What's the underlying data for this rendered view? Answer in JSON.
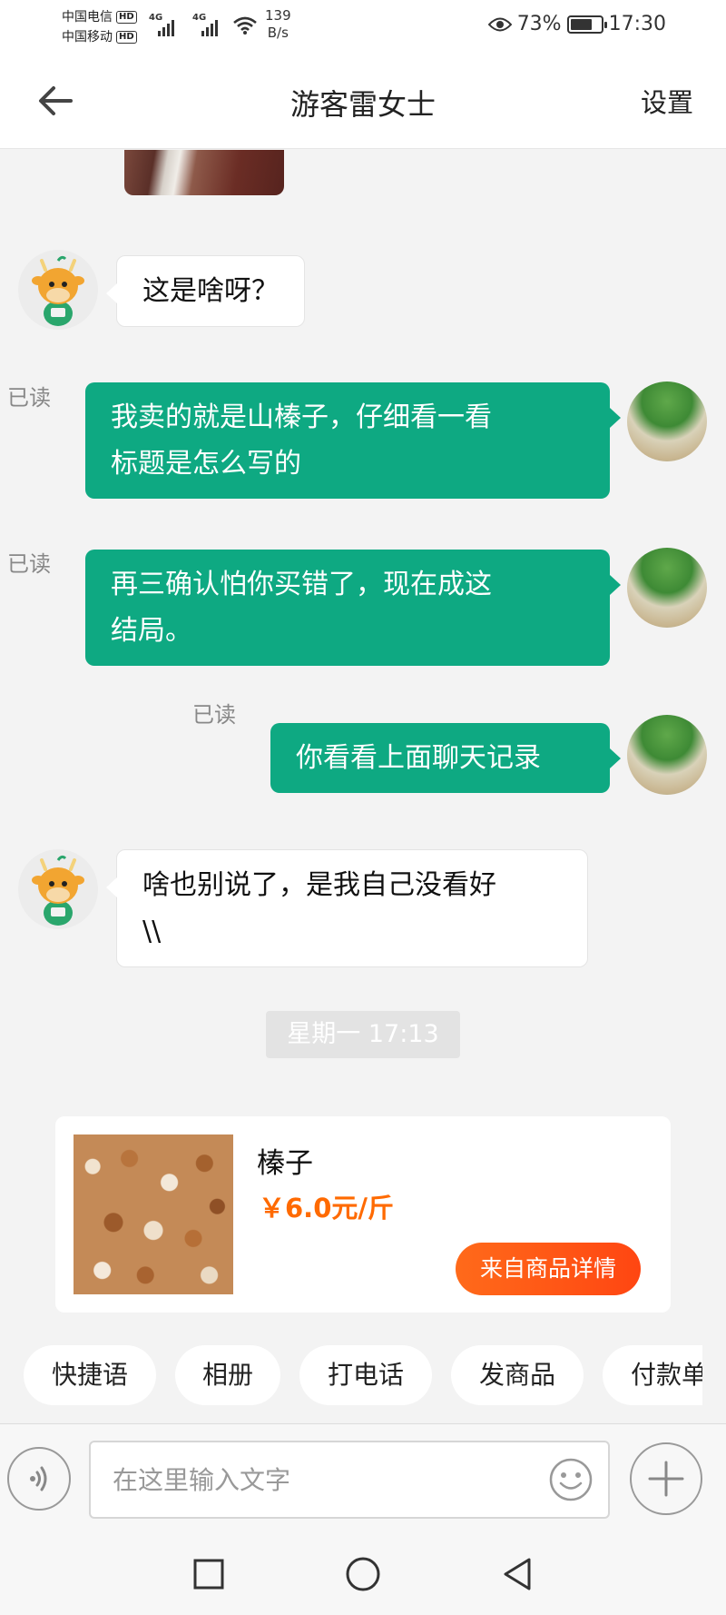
{
  "status_bar": {
    "carrier_1": "中国电信",
    "carrier_2": "中国移动",
    "hd_badge": "HD",
    "network_type": "4G",
    "net_speed_value": "139",
    "net_speed_unit": "B/s",
    "battery_percent": "73%",
    "battery_level": 0.73,
    "time": "17:30"
  },
  "header": {
    "title": "游客雷女士",
    "settings_label": "设置"
  },
  "messages": [
    {
      "side": "left",
      "text_lines": [
        "这是啥呀？"
      ]
    },
    {
      "side": "right",
      "read": "已读",
      "text_lines": [
        "我卖的就是山榛子，仔细看一看",
        "标题是怎么写的"
      ]
    },
    {
      "side": "right",
      "read": "已读",
      "text_lines": [
        "再三确认怕你买错了，现在成这",
        "结局。"
      ]
    },
    {
      "side": "right",
      "read": "已读",
      "text_lines": [
        "你看看上面聊天记录"
      ]
    },
    {
      "side": "left",
      "text_lines": [
        "啥也别说了，是我自己没看好",
        "\\\\"
      ]
    }
  ],
  "timestamp": "星期一 17:13",
  "product_card": {
    "name": "榛子",
    "price": "￥6.0元/斤",
    "link_label": "来自商品详情"
  },
  "quick_actions": [
    "快捷语",
    "相册",
    "打电话",
    "发商品",
    "付款单"
  ],
  "input_bar": {
    "placeholder": "在这里输入文字"
  },
  "colors": {
    "accent_green": "#0ea982",
    "price_orange": "#ff6a00",
    "button_orange": "#ff4612"
  },
  "icons": [
    "back-arrow-icon",
    "eye-icon",
    "battery-icon",
    "wifi-icon",
    "voice-icon",
    "emoji-icon",
    "plus-icon",
    "nav-square-icon",
    "nav-circle-icon",
    "nav-triangle-icon"
  ]
}
